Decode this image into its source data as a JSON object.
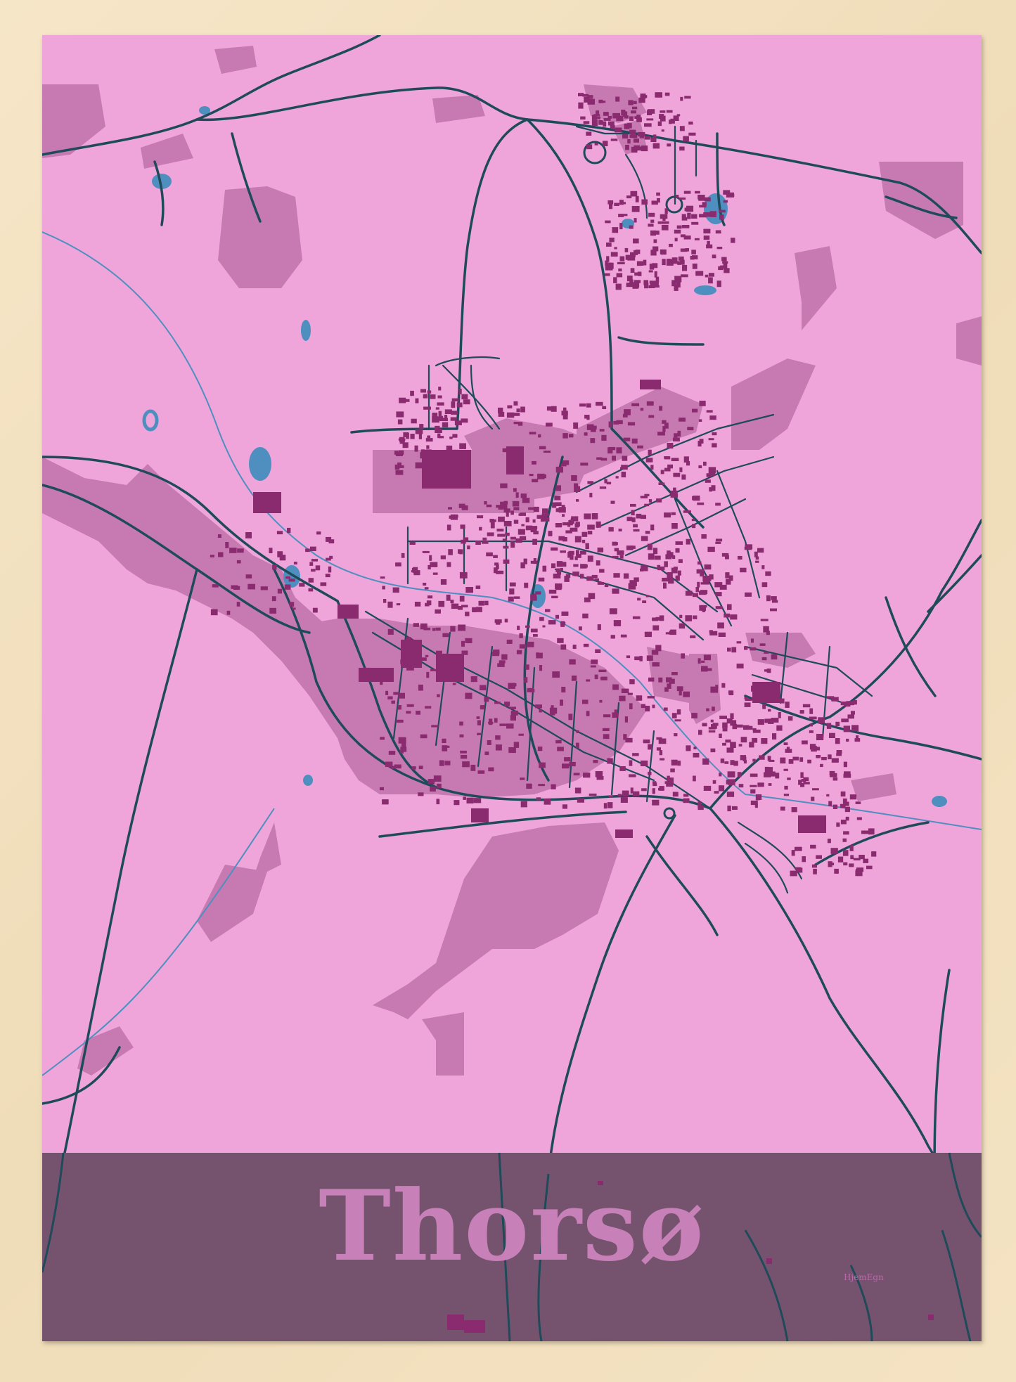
{
  "poster": {
    "title": "Thorsø",
    "brand": "HjemEgn"
  },
  "colors": {
    "frame": "#f3e3c6",
    "background": "#efa5da",
    "landuse": "#c77ab2",
    "buildings": "#8a2b70",
    "roads": "#1e4a5a",
    "water": "#4f8fbf",
    "banner": "#75536e",
    "title": "#c880b8"
  }
}
